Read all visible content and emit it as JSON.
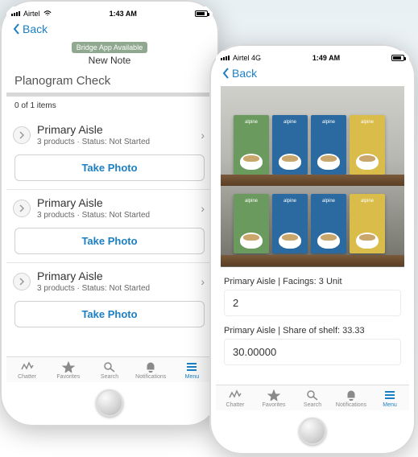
{
  "left": {
    "status": {
      "carrier": "Airtel",
      "signal_icon": "signal-icon",
      "wifi_icon": "wifi-icon",
      "time": "1:43 AM"
    },
    "nav": {
      "back": "Back"
    },
    "banner": "Bridge App Available",
    "subtitle": "New Note",
    "title": "Planogram Check",
    "counter": "0 of 1 items",
    "items": [
      {
        "title": "Primary Aisle",
        "sub": "3 products  ·  Status: Not Started",
        "action": "Take Photo"
      },
      {
        "title": "Primary Aisle",
        "sub": "3 products  ·  Status: Not Started",
        "action": "Take Photo"
      },
      {
        "title": "Primary Aisle",
        "sub": "3 products  ·  Status: Not Started",
        "action": "Take Photo"
      }
    ],
    "tabs": [
      {
        "label": "Chatter"
      },
      {
        "label": "Favorites"
      },
      {
        "label": "Search"
      },
      {
        "label": "Notifications"
      },
      {
        "label": "Menu"
      }
    ]
  },
  "right": {
    "status": {
      "carrier": "Airtel  4G",
      "time": "1:49 AM"
    },
    "nav": {
      "back": "Back"
    },
    "product_logo": "alpine",
    "fields": [
      {
        "label": "Primary Aisle | Facings: 3 Unit",
        "value": "2"
      },
      {
        "label": "Primary Aisle | Share of shelf: 33.33",
        "value": "30.00000"
      }
    ],
    "tabs": [
      {
        "label": "Chatter"
      },
      {
        "label": "Favorites"
      },
      {
        "label": "Search"
      },
      {
        "label": "Notifications"
      },
      {
        "label": "Menu"
      }
    ]
  }
}
